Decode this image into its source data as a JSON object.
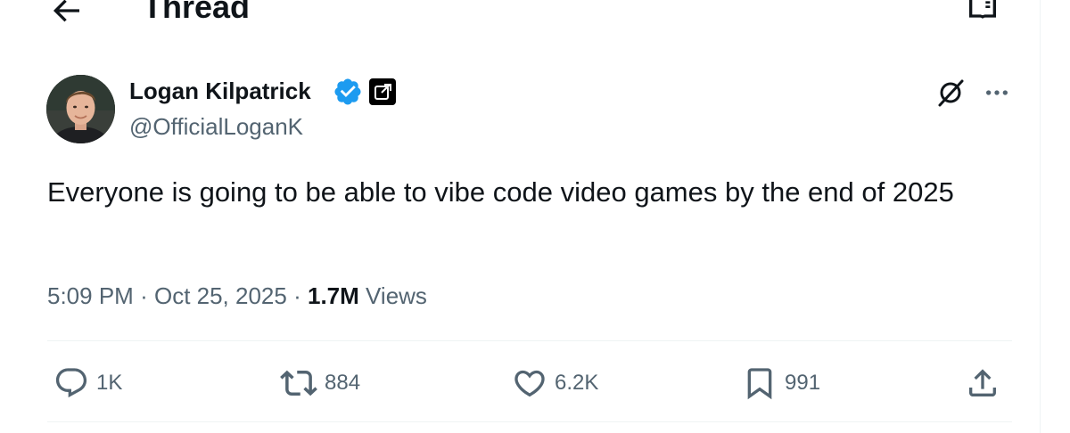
{
  "header": {
    "title": "Thread",
    "back_icon": "arrow-left-icon",
    "reader_icon": "reader-mode-icon"
  },
  "author": {
    "name": "Logan Kilpatrick",
    "handle": "@OfficialLoganK",
    "verified_icon": "verified-badge-icon",
    "verified_color": "#1d9bf0",
    "affiliate_icon": "affiliate-badge-icon"
  },
  "tweet": {
    "text": "Everyone is going to be able to vibe code video games by the end of 2025",
    "time": "5:09 PM",
    "separator": "·",
    "date": "Oct 25, 2025",
    "views_count": "1.7M",
    "views_label": "Views"
  },
  "actions": {
    "reply": {
      "icon": "reply-icon",
      "count": "1K"
    },
    "repost": {
      "icon": "repost-icon",
      "count": "884"
    },
    "like": {
      "icon": "heart-icon",
      "count": "6.2K"
    },
    "bookmark": {
      "icon": "bookmark-icon",
      "count": "991"
    },
    "share": {
      "icon": "share-icon"
    }
  },
  "top_right": {
    "grok_icon": "grok-icon",
    "more_icon": "more-dots-icon"
  },
  "colors": {
    "text_primary": "#0f1419",
    "text_secondary": "#536471",
    "divider": "#eff3f4",
    "accent": "#1d9bf0"
  }
}
